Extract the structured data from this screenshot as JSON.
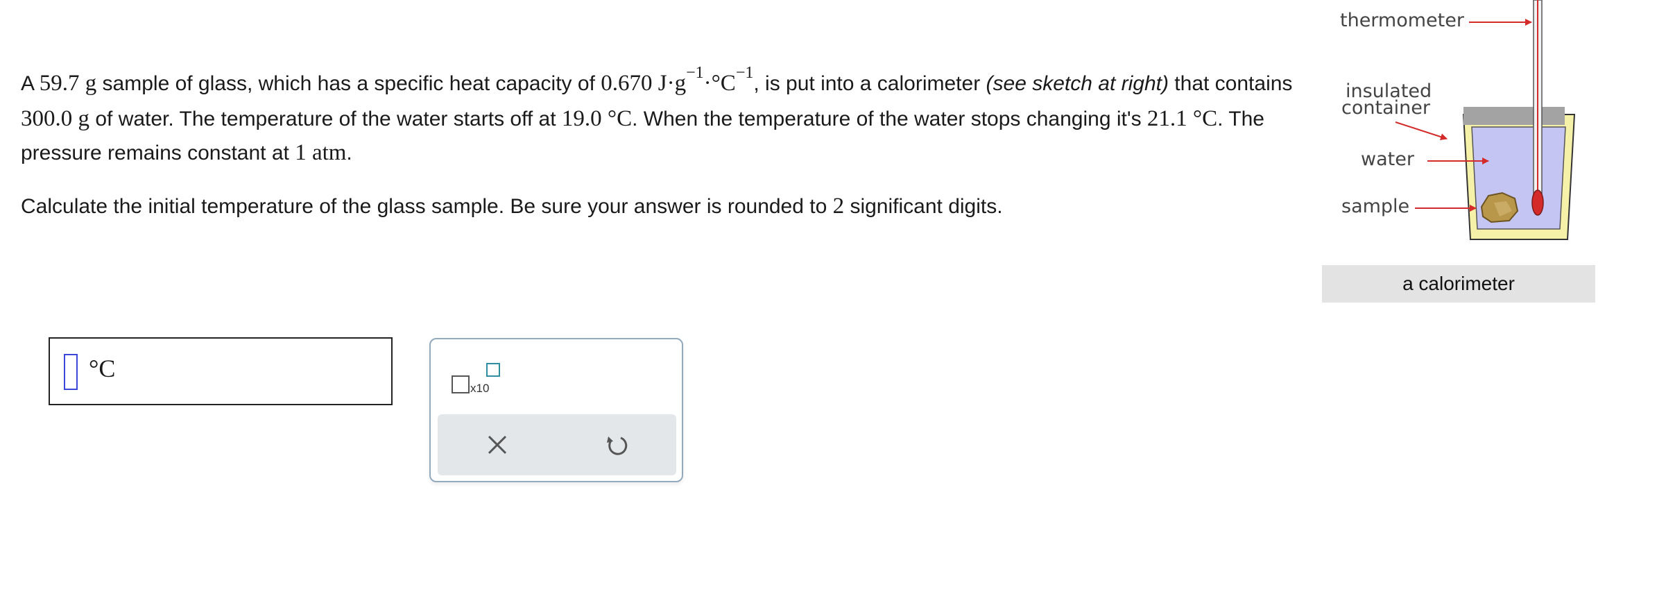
{
  "problem": {
    "p1_a": "A ",
    "mass_glass": "59.7",
    "unit_g": " g",
    "p1_b": " sample of glass, which has a specific heat capacity of ",
    "heat_capacity": "0.670",
    "heat_unit_a": "  J·g",
    "exp_a": "−1",
    "heat_unit_b": "·°C",
    "exp_b": "−1",
    "p1_c": ", is put into a calorimeter ",
    "p1_see": "(see sketch at right)",
    "p1_d": " that contains ",
    "mass_water": "300.0",
    "unit_g2": " g",
    "p1_e": " of water. The temperature of the water starts off at ",
    "t_start": "19.0 °C",
    "p1_f": ". When the temperature of the water stops changing it's ",
    "t_end": "21.1 °C",
    "p1_g": ". The pressure remains constant at ",
    "pressure": "1  atm",
    "p1_h": ".",
    "q_a": "Calculate the initial temperature of the glass sample. Be sure your answer is rounded to ",
    "sig_figs": "2",
    "q_b": " significant digits."
  },
  "sketch": {
    "thermometer": "thermometer",
    "insulated_1": "insulated",
    "insulated_2": "container",
    "water": "water",
    "sample": "sample",
    "caption": "a calorimeter"
  },
  "answer": {
    "value": "",
    "unit": "°C"
  },
  "keypad": {
    "x10_label": "x10",
    "clear_icon": "x-icon",
    "undo_icon": "undo-icon"
  },
  "colors": {
    "arrow": "#d42a2a",
    "water": "#c5c5f3",
    "container": "#f6f1a8",
    "caret": "#3b47d8",
    "tray": "#e3e7ea"
  }
}
